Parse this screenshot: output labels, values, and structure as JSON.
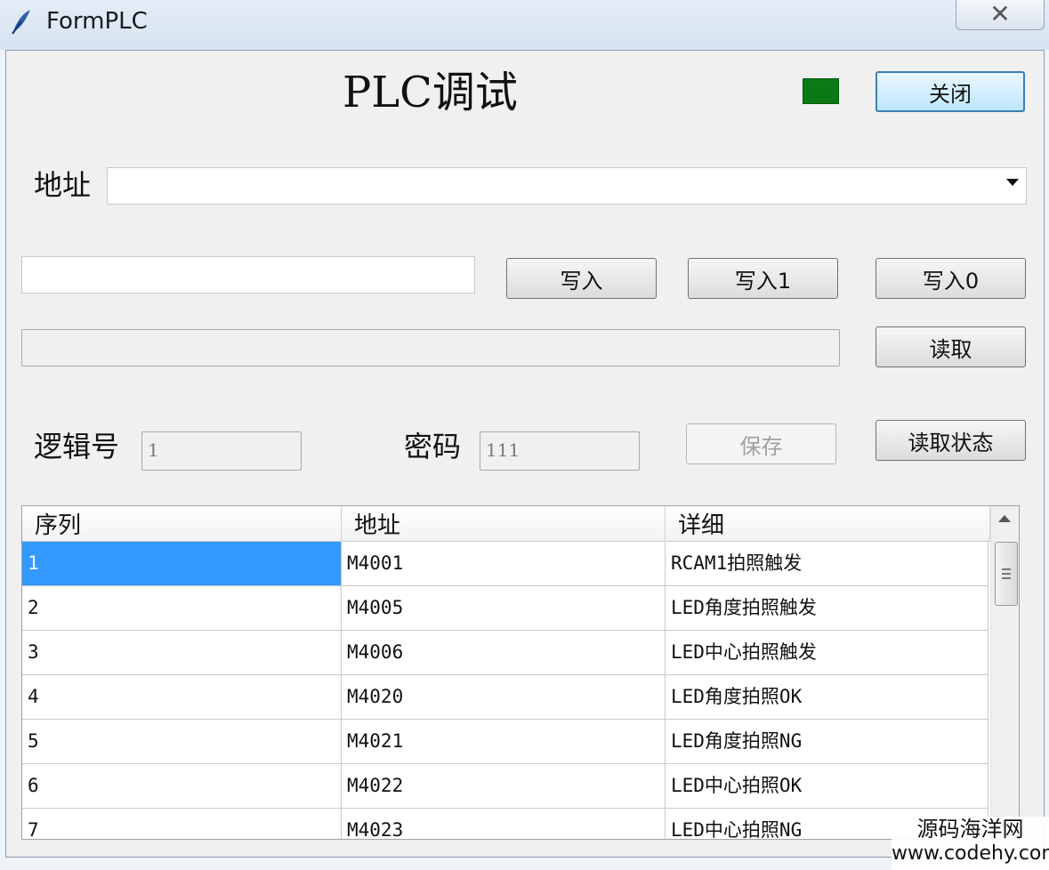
{
  "window": {
    "title": "FormPLC",
    "close_glyph": "✕",
    "icon": "feather-icon"
  },
  "form": {
    "title": "PLC调试",
    "status_color": "#0b7a15"
  },
  "buttons": {
    "close": "关闭",
    "write": "写入",
    "write1": "写入1",
    "write0": "写入0",
    "read": "读取",
    "save": "保存",
    "read_status": "读取状态"
  },
  "address": {
    "label": "地址",
    "value": ""
  },
  "write_input": {
    "value": ""
  },
  "read_output": {
    "value": ""
  },
  "logic": {
    "label": "逻辑号",
    "value": "1"
  },
  "password": {
    "label": "密码",
    "value": "111"
  },
  "grid": {
    "columns": [
      "序列",
      "地址",
      "详细"
    ],
    "rows": [
      [
        "1",
        "M4001",
        "RCAM1拍照触发"
      ],
      [
        "2",
        "M4005",
        "LED角度拍照触发"
      ],
      [
        "3",
        "M4006",
        "LED中心拍照触发"
      ],
      [
        "4",
        "M4020",
        "LED角度拍照OK"
      ],
      [
        "5",
        "M4021",
        "LED角度拍照NG"
      ],
      [
        "6",
        "M4022",
        "LED中心拍照OK"
      ],
      [
        "7",
        "M4023",
        "LED中心拍照NG"
      ]
    ],
    "selected_row": 0
  },
  "watermark": {
    "line1": "源码海洋网",
    "line2": "www.codehy.com"
  }
}
